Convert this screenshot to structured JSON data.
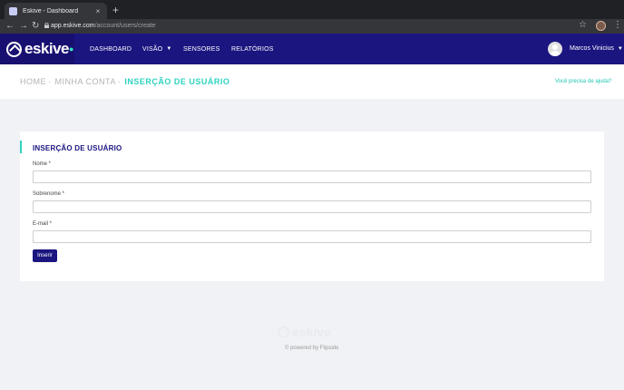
{
  "browser": {
    "tab_title": "Eskive - Dashboard",
    "tab_close": "×",
    "new_tab": "+",
    "back": "←",
    "forward": "→",
    "reload": "↻",
    "url_domain": "app.eskive.com",
    "url_path": "/account/users/create",
    "star": "☆",
    "menu": "⋮"
  },
  "app": {
    "brand": "eskive",
    "nav": {
      "dashboard": "DASHBOARD",
      "visao": "VISÃO",
      "sensores": "SENSORES",
      "relatorios": "RELATÓRIOS"
    },
    "user_name": "Marcos Vinicius"
  },
  "breadcrumb": {
    "home": "HOME",
    "account": "MINHA CONTA",
    "current": "INSERÇÃO DE USUÁRIO",
    "separator": "·"
  },
  "help": "Você precisa de ajuda?",
  "form": {
    "title": "INSERÇÃO DE USUÁRIO",
    "fields": [
      {
        "label": "Nome *",
        "value": ""
      },
      {
        "label": "Sobrenome *",
        "value": ""
      },
      {
        "label": "E-mail *",
        "value": ""
      }
    ],
    "submit": "Inserir"
  },
  "footer": {
    "brand": "eskive",
    "powered": "© powered by Flipside"
  },
  "colors": {
    "header": "#1b1580",
    "accent": "#2ed3c0"
  }
}
